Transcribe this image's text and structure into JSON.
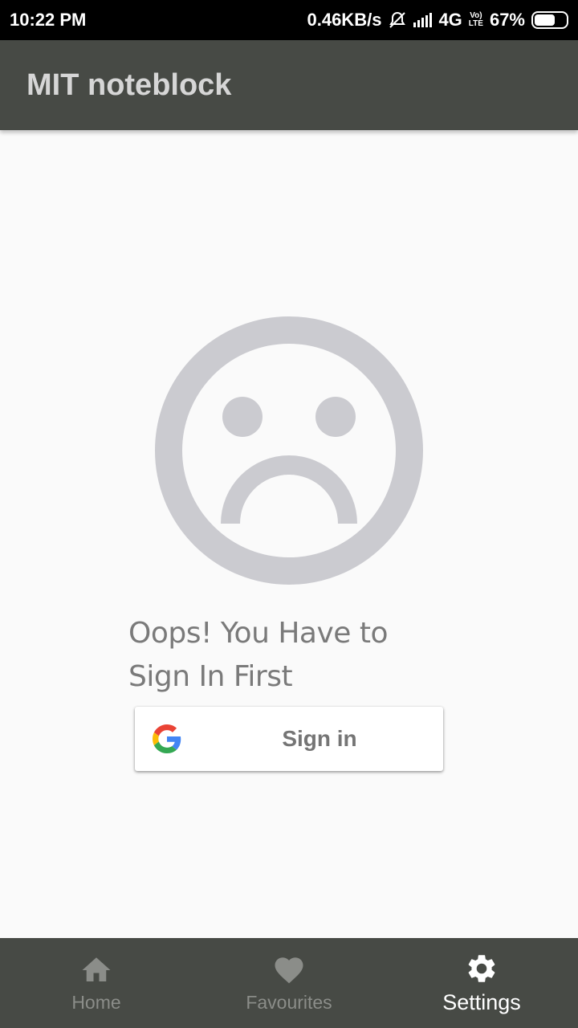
{
  "status_bar": {
    "time": "10:22 PM",
    "speed": "0.46KB/s",
    "network": "4G",
    "volte": "VoLTE",
    "battery": "67%",
    "battery_level": 0.67,
    "icons": [
      "mute-bell-icon",
      "signal-icon",
      "volte-icon",
      "battery-icon"
    ]
  },
  "app_bar": {
    "title": "MIT noteblock"
  },
  "main": {
    "illustration": "sad-face-icon",
    "message": "Oops! You Have to Sign In First",
    "signin_button": {
      "label": "Sign in",
      "icon": "google-g-icon"
    }
  },
  "bottom_nav": {
    "items": [
      {
        "label": "Home",
        "icon": "home-icon",
        "active": false
      },
      {
        "label": "Favourites",
        "icon": "heart-icon",
        "active": false
      },
      {
        "label": "Settings",
        "icon": "gear-icon",
        "active": true
      }
    ]
  },
  "colors": {
    "app_bar": "#474a45",
    "illustration": "#cbcbd0",
    "nav_inactive": "#8b8d89",
    "nav_active": "#ffffff",
    "background": "#fafafa"
  }
}
